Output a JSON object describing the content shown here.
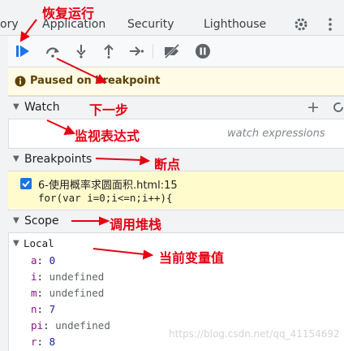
{
  "tabs": {
    "partial": "ory",
    "application": "Application",
    "security": "Security",
    "lighthouse": "Lighthouse"
  },
  "paused": {
    "text": "Paused on breakpoint"
  },
  "watch": {
    "title": "Watch",
    "placeholder": "watch expressions"
  },
  "breakpoints": {
    "title": "Breakpoints",
    "file": "6-使用概率求圆面积.html:15",
    "code": "for(var i=0;i<=n;i++){",
    "checked": true
  },
  "scope": {
    "title": "Scope",
    "local_label": "Local",
    "vars": [
      {
        "name": "a",
        "value": "0",
        "type": "num"
      },
      {
        "name": "i",
        "value": "undefined",
        "type": "undef"
      },
      {
        "name": "m",
        "value": "undefined",
        "type": "undef"
      },
      {
        "name": "n",
        "value": "7",
        "type": "num"
      },
      {
        "name": "pi",
        "value": "undefined",
        "type": "undef"
      },
      {
        "name": "r",
        "value": "8",
        "type": "num"
      }
    ]
  },
  "annotations": {
    "resume": "恢复运行",
    "step": "下一步",
    "watch": "监视表达式",
    "breakpoint": "断点",
    "callstack": "调用堆栈",
    "vars": "当前变量值"
  },
  "watermark": "https://blog.csdn.net/qq_41154692",
  "colors": {
    "annotation": "#e60012",
    "accent": "#1a73e8",
    "paused_bg": "#fffbe6",
    "breakpoint_bg": "#fffbcc"
  }
}
